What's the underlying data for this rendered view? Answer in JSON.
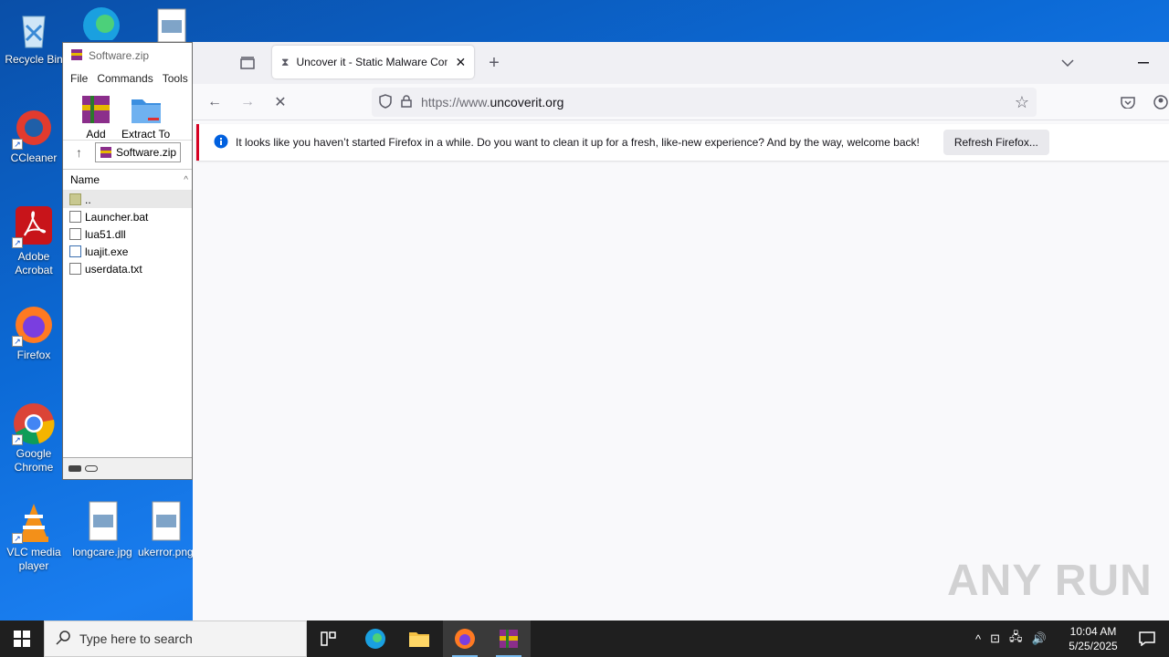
{
  "desktop": {
    "icons": [
      {
        "name": "recycle-bin",
        "label": "Recycle Bin"
      },
      {
        "name": "ccleaner",
        "label": "CCleaner"
      },
      {
        "name": "adobe-acrobat",
        "label": "Adobe Acrobat"
      },
      {
        "name": "firefox",
        "label": "Firefox"
      },
      {
        "name": "google-chrome",
        "label": "Google Chrome"
      },
      {
        "name": "vlc",
        "label": "VLC media player"
      },
      {
        "name": "longcare",
        "label": "longcare.jpg"
      },
      {
        "name": "ukerror",
        "label": "ukerror.png"
      }
    ]
  },
  "winrar": {
    "title": "Software.zip",
    "menu": [
      "File",
      "Commands",
      "Tools"
    ],
    "tools": {
      "add": "Add",
      "extract": "Extract To"
    },
    "path": "Software.zip",
    "column": "Name",
    "files": [
      "..",
      "Launcher.bat",
      "lua51.dll",
      "luajit.exe",
      "userdata.txt"
    ]
  },
  "firefox": {
    "tab_title": "Uncover it - Static Malware Con",
    "url_prefix": "https://www.",
    "url_domain": "uncoverit.org",
    "notification": "It looks like you haven’t started Firefox in a while. Do you want to clean it up for a fresh, like-new experience? And by the way, welcome back!",
    "refresh_label": "Refresh Firefox..."
  },
  "watermark": "ANY RUN",
  "taskbar": {
    "search_placeholder": "Type here to search",
    "time": "10:04 AM",
    "date": "5/25/2025"
  }
}
